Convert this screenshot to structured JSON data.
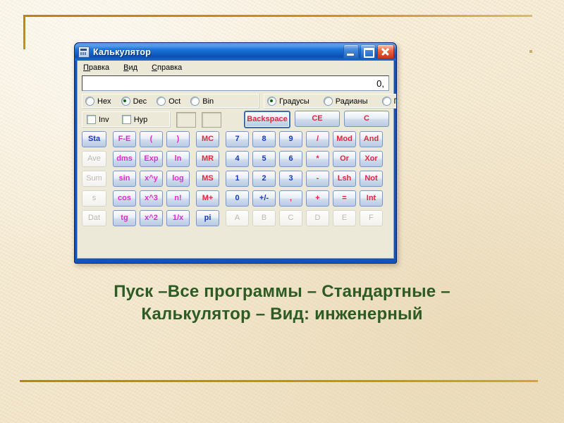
{
  "slide": {
    "background_color": "#f4e9ce",
    "rule_color": "#b8860b",
    "caption_color": "#2d5b23",
    "caption_line1": "Пуск –Все программы – Стандартные –",
    "caption_line2": "Калькулятор – Вид: инженерный"
  },
  "window": {
    "title": "Калькулятор",
    "icon": "calculator-icon",
    "titlebar_color": "#1467cb",
    "buttons": {
      "minimize": "Свернуть",
      "maximize": "Развернуть",
      "close": "Закрыть"
    }
  },
  "menu": [
    {
      "label": "Правка",
      "accel": "П"
    },
    {
      "label": "Вид",
      "accel": "В"
    },
    {
      "label": "Справка",
      "accel": "С"
    }
  ],
  "display": {
    "value": "0,",
    "placeholder": "0,"
  },
  "base_group": [
    {
      "label": "Hex",
      "selected": false
    },
    {
      "label": "Dec",
      "selected": true
    },
    {
      "label": "Oct",
      "selected": false
    },
    {
      "label": "Bin",
      "selected": false
    }
  ],
  "angle_group": [
    {
      "label": "Градусы",
      "selected": true
    },
    {
      "label": "Радианы",
      "selected": false
    },
    {
      "label": "Грады",
      "selected": false
    }
  ],
  "modifiers": [
    {
      "label": "Inv",
      "checked": false
    },
    {
      "label": "Hyp",
      "checked": false
    }
  ],
  "indicator_boxes": 2,
  "top_buttons": [
    {
      "label": "Backspace",
      "color": "red",
      "focused": true
    },
    {
      "label": "CE",
      "color": "red",
      "focused": false
    },
    {
      "label": "C",
      "color": "red",
      "focused": false
    }
  ],
  "stat_column": [
    {
      "label": "Sta",
      "color": "blue",
      "disabled": false
    },
    {
      "label": "Ave",
      "color": "blue",
      "disabled": true
    },
    {
      "label": "Sum",
      "color": "blue",
      "disabled": true
    },
    {
      "label": "s",
      "color": "blue",
      "disabled": true
    },
    {
      "label": "Dat",
      "color": "blue",
      "disabled": true
    }
  ],
  "sci_rows": [
    [
      {
        "label": "F-E",
        "color": "magenta"
      },
      {
        "label": "(",
        "color": "magenta"
      },
      {
        "label": ")",
        "color": "magenta"
      }
    ],
    [
      {
        "label": "dms",
        "color": "magenta"
      },
      {
        "label": "Exp",
        "color": "magenta"
      },
      {
        "label": "ln",
        "color": "magenta"
      }
    ],
    [
      {
        "label": "sin",
        "color": "magenta"
      },
      {
        "label": "x^y",
        "color": "magenta"
      },
      {
        "label": "log",
        "color": "magenta"
      }
    ],
    [
      {
        "label": "cos",
        "color": "magenta"
      },
      {
        "label": "x^3",
        "color": "magenta"
      },
      {
        "label": "n!",
        "color": "magenta"
      }
    ],
    [
      {
        "label": "tg",
        "color": "magenta"
      },
      {
        "label": "x^2",
        "color": "magenta"
      },
      {
        "label": "1/x",
        "color": "magenta"
      }
    ]
  ],
  "memory_column": [
    {
      "label": "MC",
      "color": "red"
    },
    {
      "label": "MR",
      "color": "red"
    },
    {
      "label": "MS",
      "color": "red"
    },
    {
      "label": "M+",
      "color": "red"
    },
    {
      "label": "pi",
      "color": "blue"
    }
  ],
  "numpad_rows": [
    [
      {
        "label": "7",
        "color": "blue"
      },
      {
        "label": "8",
        "color": "blue"
      },
      {
        "label": "9",
        "color": "blue"
      },
      {
        "label": "/",
        "color": "red"
      },
      {
        "label": "Mod",
        "color": "red"
      },
      {
        "label": "And",
        "color": "red"
      }
    ],
    [
      {
        "label": "4",
        "color": "blue"
      },
      {
        "label": "5",
        "color": "blue"
      },
      {
        "label": "6",
        "color": "blue"
      },
      {
        "label": "*",
        "color": "red"
      },
      {
        "label": "Or",
        "color": "red"
      },
      {
        "label": "Xor",
        "color": "red"
      }
    ],
    [
      {
        "label": "1",
        "color": "blue"
      },
      {
        "label": "2",
        "color": "blue"
      },
      {
        "label": "3",
        "color": "blue"
      },
      {
        "label": "-",
        "color": "red"
      },
      {
        "label": "Lsh",
        "color": "red"
      },
      {
        "label": "Not",
        "color": "red"
      }
    ],
    [
      {
        "label": "0",
        "color": "blue"
      },
      {
        "label": "+/-",
        "color": "blue"
      },
      {
        "label": ",",
        "color": "red"
      },
      {
        "label": "+",
        "color": "red"
      },
      {
        "label": "=",
        "color": "red"
      },
      {
        "label": "Int",
        "color": "red"
      }
    ],
    [
      {
        "label": "A",
        "color": "blue",
        "disabled": true
      },
      {
        "label": "B",
        "color": "blue",
        "disabled": true
      },
      {
        "label": "C",
        "color": "blue",
        "disabled": true
      },
      {
        "label": "D",
        "color": "blue",
        "disabled": true
      },
      {
        "label": "E",
        "color": "blue",
        "disabled": true
      },
      {
        "label": "F",
        "color": "blue",
        "disabled": true
      }
    ]
  ]
}
